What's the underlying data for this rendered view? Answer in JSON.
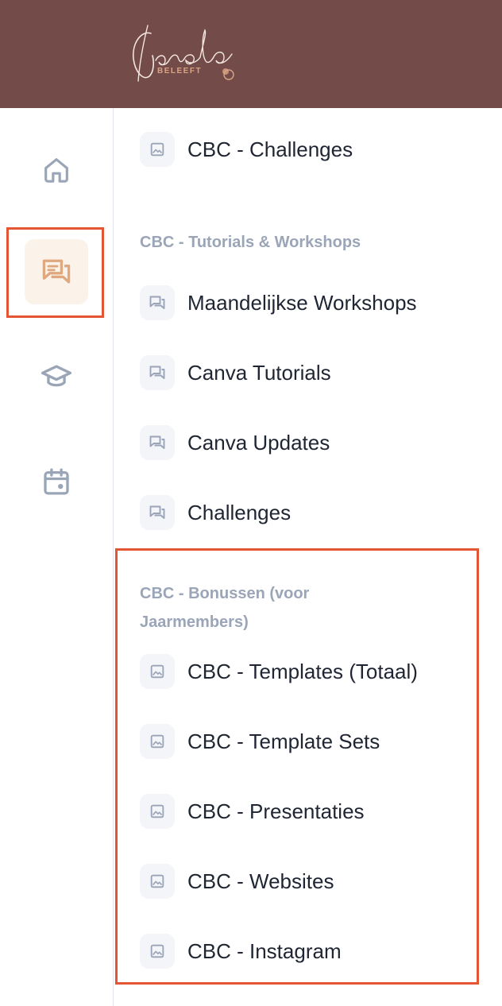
{
  "colors": {
    "header_bg": "#734b48",
    "active_icon": "#dfa87e",
    "active_bg": "#fbf2ea",
    "inactive_icon": "#9aa5b7",
    "highlight": "#e35533",
    "section_title": "#9aa5b7"
  },
  "brand": {
    "logo_script": "Carola",
    "logo_sub": "BELEEFT"
  },
  "sidebar": {
    "items": [
      {
        "name": "home",
        "icon": "home-icon",
        "active": false
      },
      {
        "name": "community",
        "icon": "chat-bubbles-icon",
        "active": true
      },
      {
        "name": "courses",
        "icon": "graduation-cap-icon",
        "active": false
      },
      {
        "name": "events",
        "icon": "calendar-icon",
        "active": false
      }
    ]
  },
  "content": {
    "top_item": {
      "label": "CBC - Challenges",
      "icon": "image-icon"
    },
    "sections": [
      {
        "title": "CBC - Tutorials & Workshops",
        "items": [
          {
            "label": "Maandelijkse Workshops",
            "icon": "chat-icon"
          },
          {
            "label": "Canva Tutorials",
            "icon": "chat-icon"
          },
          {
            "label": "Canva Updates",
            "icon": "chat-icon"
          },
          {
            "label": "Challenges",
            "icon": "chat-icon"
          }
        ]
      },
      {
        "title_line1": "CBC - Bonussen (voor",
        "title_line2": "Jaarmembers)",
        "items": [
          {
            "label": "CBC - Templates (Totaal)",
            "icon": "image-icon"
          },
          {
            "label": "CBC - Template Sets",
            "icon": "image-icon"
          },
          {
            "label": "CBC - Presentaties",
            "icon": "image-icon"
          },
          {
            "label": "CBC - Websites",
            "icon": "image-icon"
          },
          {
            "label": "CBC - Instagram",
            "icon": "image-icon"
          }
        ]
      }
    ]
  }
}
